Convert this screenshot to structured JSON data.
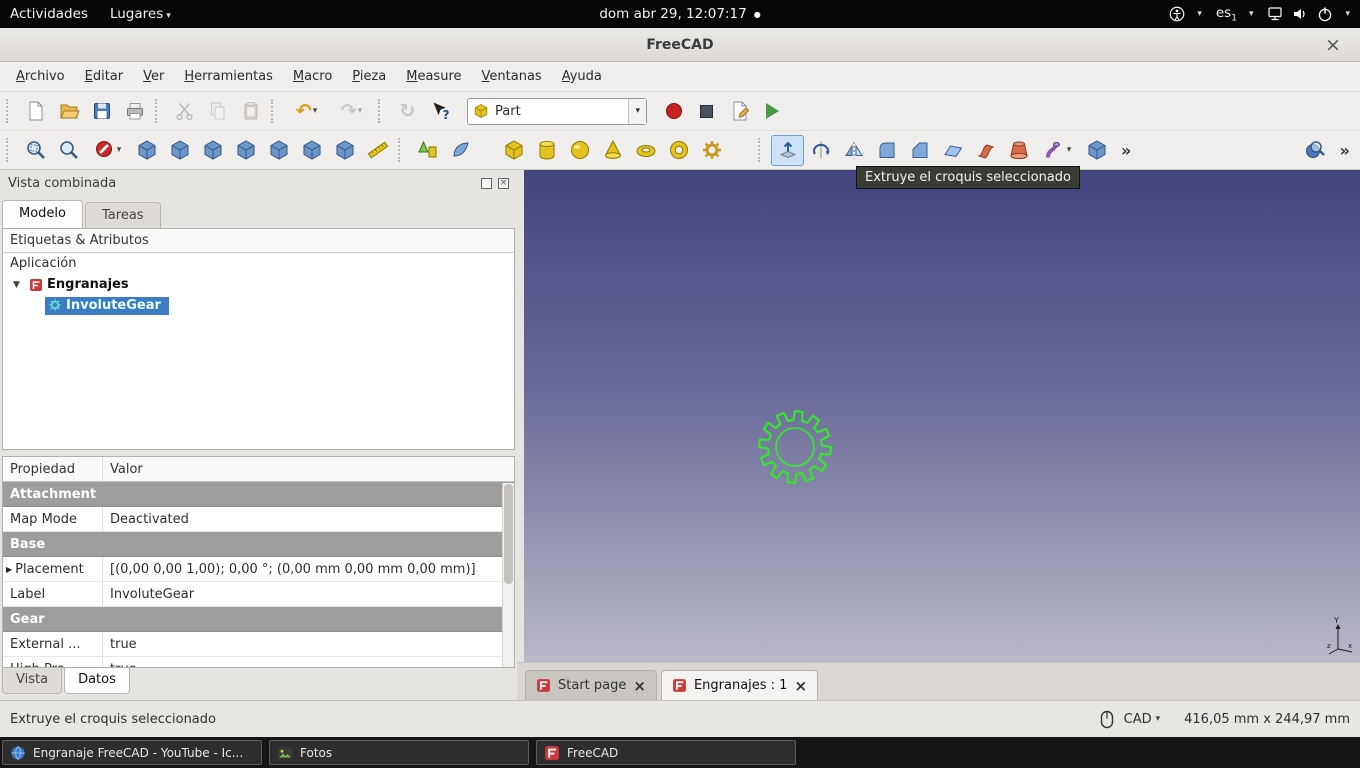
{
  "icons": {
    "caret": "▾",
    "close": "×",
    "collapse": "▼",
    "expand": "▶",
    "overflow": "»",
    "undo": "↶",
    "redo": "↷",
    "refresh": "↻",
    "dot": "●"
  },
  "gnome_bar": {
    "activities": "Actividades",
    "places": "Lugares",
    "clock": "dom abr 29, 12:07:17",
    "keyboard_layout": "es",
    "keyboard_layout_index": "1"
  },
  "window": {
    "title": "FreeCAD"
  },
  "menubar": {
    "items": [
      "Archivo",
      "Editar",
      "Ver",
      "Herramientas",
      "Macro",
      "Pieza",
      "Measure",
      "Ventanas",
      "Ayuda"
    ]
  },
  "toolbars": {
    "workbench_selected": "Part"
  },
  "tooltip": {
    "text": "Extruye el croquis seleccionado"
  },
  "combo_view": {
    "title": "Vista combinada",
    "tabs": {
      "model": "Modelo",
      "tasks": "Tareas"
    },
    "tree_header": "Etiquetas & Atributos",
    "application": "Aplicación",
    "document": "Engranajes",
    "object": "InvoluteGear",
    "property_columns": {
      "name": "Propiedad",
      "value": "Valor"
    },
    "properties": [
      {
        "label": "Attachment",
        "group": true
      },
      {
        "label": "Map Mode",
        "value": "Deactivated"
      },
      {
        "label": "Base",
        "group": true
      },
      {
        "label": "Placement",
        "value": "[(0,00 0,00 1,00); 0,00 °; (0,00 mm  0,00 mm  0,00 mm)]"
      },
      {
        "label": "Label",
        "value": "InvoluteGear"
      },
      {
        "label": "Gear",
        "group": true
      },
      {
        "label": "External ...",
        "value": "true"
      },
      {
        "label": "High Pre...",
        "value": "true"
      }
    ],
    "bottom_tabs": {
      "view": "Vista",
      "data": "Datos"
    }
  },
  "mdi_tabs": [
    {
      "label": "Start page"
    },
    {
      "label": "Engranajes : 1"
    }
  ],
  "status_bar": {
    "message": "Extruye el croquis seleccionado",
    "nav_style": "CAD",
    "dimensions": "416,05 mm x 244,97 mm"
  },
  "taskbar": {
    "windows": [
      "Engranaje FreeCAD - YouTube - Ic...",
      "Fotos",
      "FreeCAD"
    ]
  }
}
